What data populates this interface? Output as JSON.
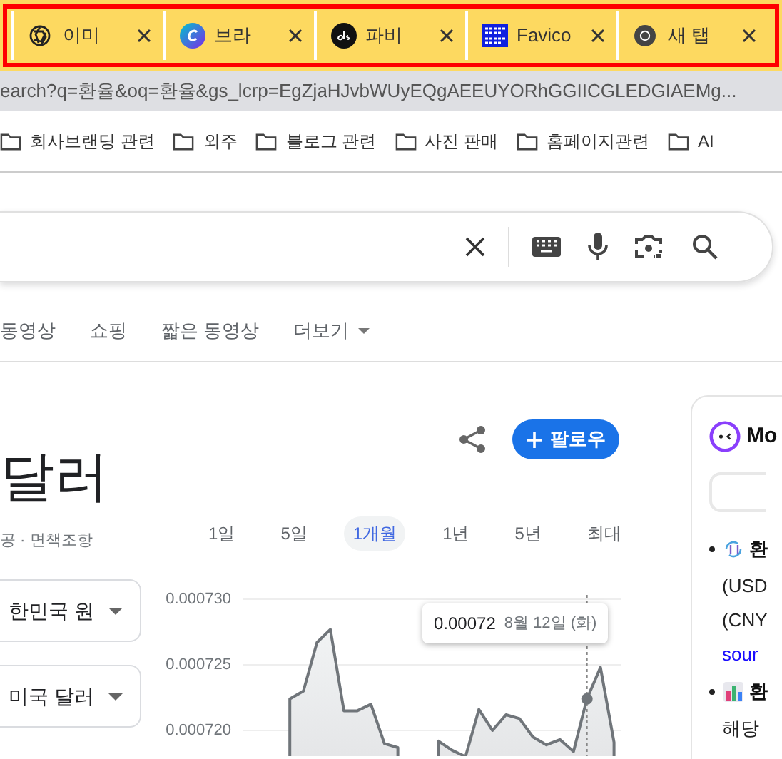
{
  "tabs": [
    {
      "title": "이미"
    },
    {
      "title": "브라"
    },
    {
      "title": "파비"
    },
    {
      "title": "Favico"
    },
    {
      "title": "새 탭"
    }
  ],
  "address_bar": {
    "url": "earch?q=환율&oq=환율&gs_lcrp=EgZjaHJvbWUyEQgAEEUYORhGGIICGLEDGIAEMg..."
  },
  "bookmarks": [
    "회사브랜딩 관련",
    "외주",
    "블로그 관련",
    "사진 판매",
    "홈페이지관련",
    "AI"
  ],
  "search_nav": {
    "items": [
      "동영상",
      "쇼핑",
      "짧은 동영상"
    ],
    "more": "더보기"
  },
  "follow_button": "팔로우",
  "title": "달러",
  "source_note": "공 · 면책조항",
  "periods": [
    {
      "label": "1일",
      "selected": false
    },
    {
      "label": "5일",
      "selected": false
    },
    {
      "label": "1개월",
      "selected": true
    },
    {
      "label": "1년",
      "selected": false
    },
    {
      "label": "5년",
      "selected": false
    },
    {
      "label": "최대",
      "selected": false
    }
  ],
  "converters": [
    "한민국 원",
    "미국 달러"
  ],
  "chart": {
    "chart_data": {
      "type": "area",
      "grid": true,
      "ylim": [
        0.000718,
        0.00073
      ],
      "yticks": [
        {
          "value": 0.00073,
          "label": "0.000730"
        },
        {
          "value": 0.000725,
          "label": "0.000725"
        },
        {
          "value": 0.00072,
          "label": "0.000720"
        }
      ],
      "series": [
        {
          "color": "#70757a",
          "values": [
            null,
            null,
            null,
            0.0007224,
            0.000723,
            0.0007267,
            0.0007277,
            0.0007215,
            0.0007215,
            0.000722,
            0.000719,
            0.0007187,
            null,
            null,
            0.0007192,
            0.0007185,
            0.000718,
            0.0007216,
            0.00072,
            0.0007212,
            0.0007209,
            0.0007195,
            0.0007189,
            0.0007193,
            0.0007184,
            0.0007224,
            0.0007248,
            0.0007191
          ]
        }
      ]
    },
    "tooltip": {
      "value": "0.00072",
      "date": "8월 12일 (화)"
    }
  },
  "assistant_card": {
    "title": "Mo",
    "items": [
      {
        "heading": "환",
        "lines": [
          "(USD",
          "(CNY"
        ],
        "link": "sour"
      },
      {
        "heading": "환",
        "lines": [
          "해당"
        ]
      }
    ]
  }
}
